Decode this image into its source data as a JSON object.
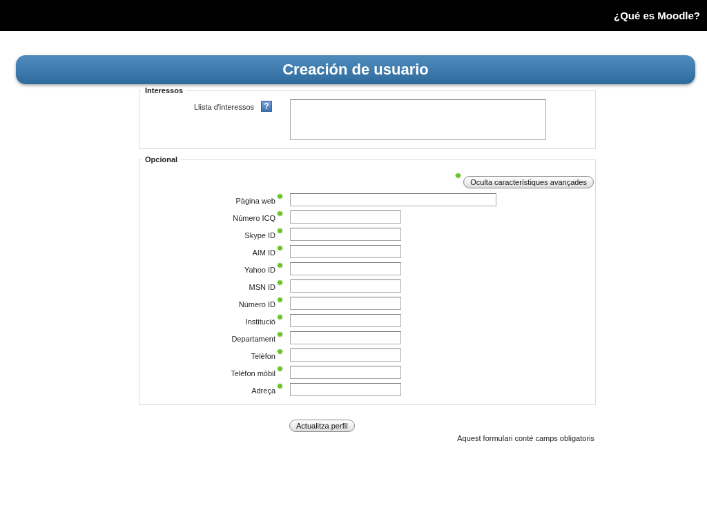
{
  "header": {
    "title": "¿Qué es Moodle?"
  },
  "banner": {
    "title": "Creación de usuario"
  },
  "sections": [
    {
      "legend": "Interessos",
      "fields": [
        {
          "label": "Llista d'interessos",
          "kind": "textarea",
          "help": "?",
          "advanced": false
        }
      ]
    },
    {
      "legend": "Opcional",
      "toggle": {
        "label": "Oculta característiques avançades",
        "advanced": true
      },
      "fields": [
        {
          "label": "Pàgina web",
          "kind": "wide",
          "advanced": true
        },
        {
          "label": "Número ICQ",
          "kind": "short",
          "advanced": true
        },
        {
          "label": "Skype ID",
          "kind": "short",
          "advanced": true
        },
        {
          "label": "AIM ID",
          "kind": "short",
          "advanced": true
        },
        {
          "label": "Yahoo ID",
          "kind": "short",
          "advanced": true
        },
        {
          "label": "MSN ID",
          "kind": "short",
          "advanced": true
        },
        {
          "label": "Número ID",
          "kind": "short",
          "advanced": true
        },
        {
          "label": "Institució",
          "kind": "short",
          "advanced": true
        },
        {
          "label": "Departament",
          "kind": "short",
          "advanced": true
        },
        {
          "label": "Telèfon",
          "kind": "short",
          "advanced": true
        },
        {
          "label": "Telèfon mòbil",
          "kind": "short",
          "advanced": true
        },
        {
          "label": "Adreça",
          "kind": "short",
          "advanced": true
        }
      ]
    }
  ],
  "submit": {
    "label": "Actualitza perfil"
  },
  "note": "Aquest formulari conté camps obligatoris"
}
